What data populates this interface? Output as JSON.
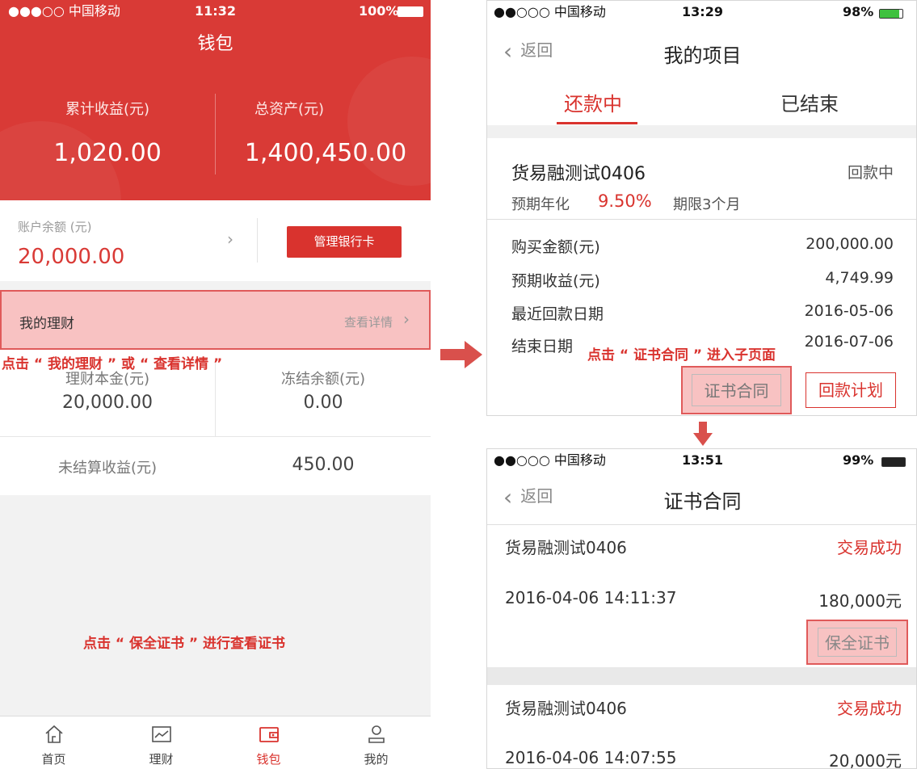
{
  "left_phone": {
    "status": {
      "carrier": "●●●○○ 中国移动",
      "time": "11:32",
      "battery": "100%"
    },
    "title": "钱包",
    "cumulative_income": {
      "label": "累计收益(元)",
      "value": "1,020.00"
    },
    "total_assets": {
      "label": "总资产(元)",
      "value": "1,400,450.00"
    },
    "balance": {
      "label": "账户余额 (元)",
      "value": "20,000.00",
      "manage_button": "管理银行卡"
    },
    "my_finance": {
      "label": "我的理财",
      "detail": "查看详情"
    },
    "annotation": "点击 “ 我的理财 ” 或 “ 查看详情 ”",
    "principal": {
      "label": "理财本金(元)",
      "value": "20,000.00"
    },
    "frozen": {
      "label": "冻结余额(元)",
      "value": "0.00"
    },
    "unsettled": {
      "label": "未结算收益(元)",
      "value": "450.00"
    },
    "tabs": [
      {
        "label": "首页",
        "icon": "home-icon"
      },
      {
        "label": "理财",
        "icon": "chart-icon"
      },
      {
        "label": "钱包",
        "icon": "wallet-icon"
      },
      {
        "label": "我的",
        "icon": "user-icon"
      }
    ]
  },
  "top_right_phone": {
    "status": {
      "carrier": "●●○○○ 中国移动",
      "time": "13:29",
      "battery": "98%"
    },
    "back": "返回",
    "title": "我的项目",
    "tabs": [
      "还款中",
      "已结束"
    ],
    "project": {
      "name": "货易融测试0406",
      "status": "回款中",
      "rate_label": "预期年化",
      "rate": "9.50%",
      "term": "期限3个月"
    },
    "rows": [
      {
        "label": "购买金额(元)",
        "value": "200,000.00"
      },
      {
        "label": "预期收益(元)",
        "value": "4,749.99"
      },
      {
        "label": "最近回款日期",
        "value": "2016-05-06"
      },
      {
        "label": "结束日期",
        "value": "2016-07-06"
      }
    ],
    "annotation": "点击 “ 证书合同 ” 进入子页面",
    "contract_button": "证书合同",
    "plan_button": "回款计划"
  },
  "bottom_right_phone": {
    "status": {
      "carrier": "●●○○○ 中国移动",
      "time": "13:51",
      "battery": "99%"
    },
    "back": "返回",
    "title": "证书合同",
    "records": [
      {
        "name": "货易融测试0406",
        "status": "交易成功",
        "time": "2016-04-06 14:11:37",
        "amount": "180,000元"
      },
      {
        "name": "货易融测试0406",
        "status": "交易成功",
        "time": "2016-04-06 14:07:55",
        "amount": "20,000元"
      }
    ],
    "annotation": "点击 “ 保全证书 ” 进行查看证书",
    "cert_button": "保全证书"
  },
  "colors": {
    "brand_red": "#d9332e",
    "highlight": "#f8c2c2"
  }
}
